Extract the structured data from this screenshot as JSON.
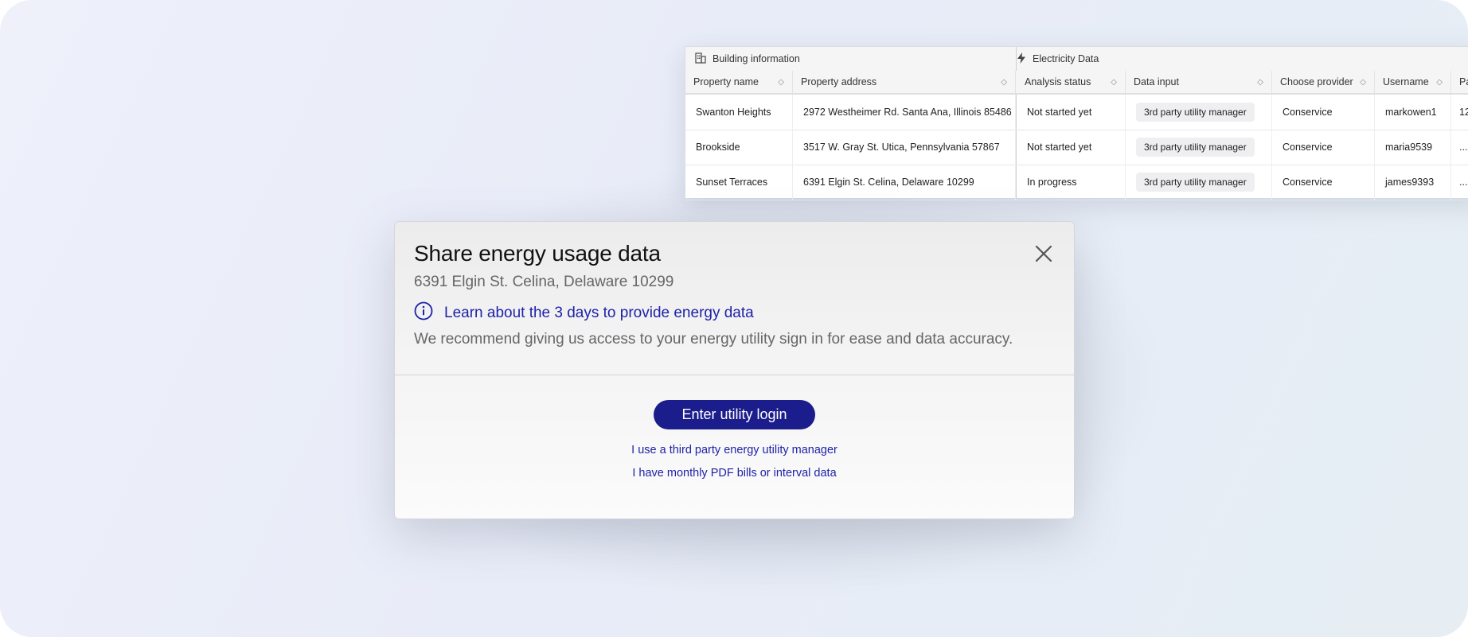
{
  "table": {
    "groups": {
      "building": "Building information",
      "electricity": "Electricity Data"
    },
    "headers": [
      "Property name",
      "Property address",
      "Analysis status",
      "Data input",
      "Choose provider",
      "Username",
      "Pa"
    ],
    "rows": [
      {
        "name": "Swanton Heights",
        "address": "2972 Westheimer Rd. Santa Ana, Illinois 85486",
        "status": "Not started yet",
        "input": "3rd party utility manager",
        "provider": "Conservice",
        "username": "markowen1",
        "extra": "12"
      },
      {
        "name": "Brookside",
        "address": "3517 W. Gray St. Utica, Pennsylvania 57867",
        "status": "Not started yet",
        "input": "3rd party utility manager",
        "provider": "Conservice",
        "username": "maria9539",
        "extra": "...."
      },
      {
        "name": "Sunset Terraces",
        "address": "6391 Elgin St. Celina, Delaware 10299",
        "status": "In progress",
        "input": "3rd party utility manager",
        "provider": "Conservice",
        "username": "james9393",
        "extra": "...."
      }
    ]
  },
  "modal": {
    "title": "Share energy usage data",
    "address": "6391 Elgin St. Celina, Delaware 10299",
    "learn_link": "Learn about the 3 days to provide energy data",
    "recommendation": "We recommend giving us access to your energy utility sign in for ease and data accuracy.",
    "primary_button": "Enter utility login",
    "third_party_link": "I use a third party energy utility manager",
    "pdf_link": "I have monthly PDF bills or interval data"
  },
  "icons": {
    "building": "building-icon",
    "bolt": "bolt-icon",
    "sort": "sort-icon",
    "info": "info-icon",
    "close": "close-icon"
  },
  "colors": {
    "accent": "#1c1d8c",
    "link": "#1f22a8"
  }
}
